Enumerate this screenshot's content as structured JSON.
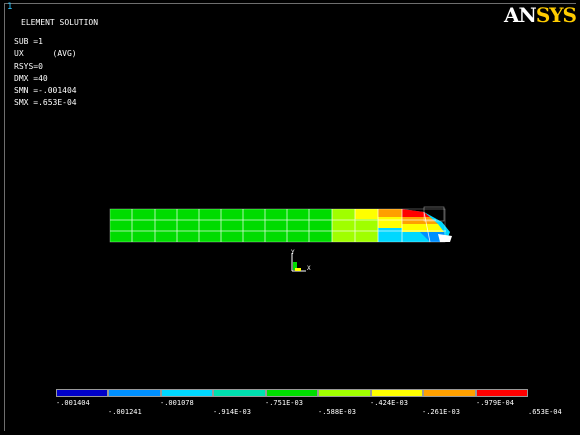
{
  "window": {
    "number": "1"
  },
  "logo": {
    "part1": "AN",
    "part2": "SYS"
  },
  "info": {
    "title": "ELEMENT SOLUTION",
    "lines": [
      "SUB =1",
      "UX      (AVG)",
      "RSYS=0",
      "DMX =40",
      "SMN =-.001404",
      "SMX =.653E-04"
    ]
  },
  "legend": {
    "colors": [
      "#0000c8",
      "#0090ff",
      "#00d8ff",
      "#00e0b0",
      "#00dc00",
      "#a0ff00",
      "#ffff00",
      "#ffa000",
      "#ff0000"
    ],
    "labels_top": [
      "-.001404",
      "-.001078",
      "-.751E-03",
      "-.424E-03",
      "-.979E-04"
    ],
    "labels_bottom": [
      "-.001241",
      "-.914E-03",
      "-.588E-03",
      "-.261E-03",
      ".653E-04"
    ]
  },
  "triad": {
    "y_label": "Y",
    "x_label": "X"
  }
}
